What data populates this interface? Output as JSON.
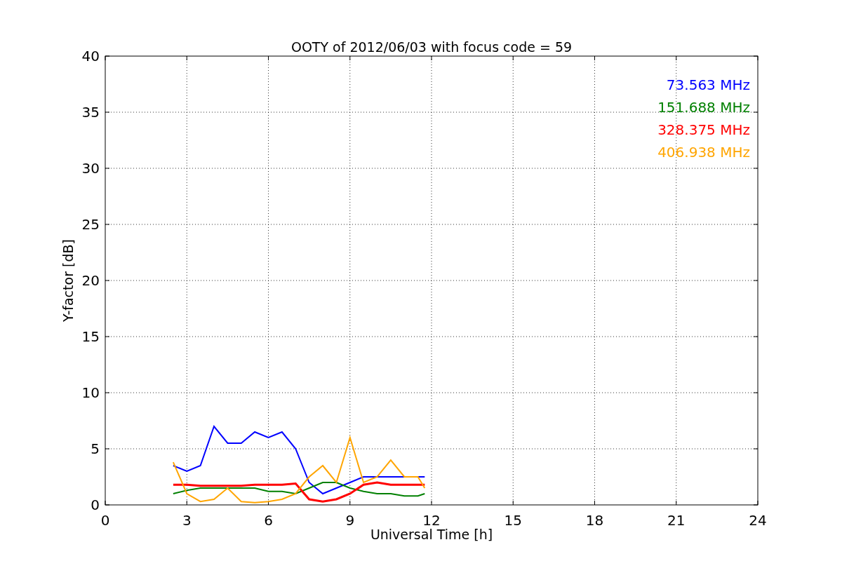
{
  "figure": {
    "chart_data": {
      "type": "line",
      "title": "OOTY of 2012/06/03 with focus code = 59",
      "xlabel": "Universal Time [h]",
      "ylabel": "Y-factor [dB]",
      "x": [
        2.5,
        3,
        3.5,
        4,
        4.5,
        5,
        5.5,
        6,
        6.5,
        7,
        7.5,
        8,
        8.5,
        9,
        9.5,
        10,
        10.5,
        11,
        11.5,
        11.75
      ],
      "series": [
        {
          "name": "73.563 MHz",
          "color": "#0000ff",
          "values": [
            3.5,
            3,
            3.5,
            7,
            5.5,
            5.5,
            6.5,
            6,
            6.5,
            5,
            2,
            1,
            1.5,
            2,
            2.5,
            2.5,
            2.5,
            2.5,
            2.5,
            2.5
          ]
        },
        {
          "name": "151.688 MHz",
          "color": "#008000",
          "values": [
            1,
            1.3,
            1.5,
            1.5,
            1.5,
            1.5,
            1.5,
            1.2,
            1.2,
            1,
            1.5,
            2,
            2,
            1.5,
            1.2,
            1,
            1,
            0.8,
            0.8,
            1
          ]
        },
        {
          "name": "328.375 MHz",
          "color": "#ff0000",
          "values": [
            1.8,
            1.8,
            1.7,
            1.7,
            1.7,
            1.7,
            1.8,
            1.8,
            1.8,
            1.9,
            0.5,
            0.3,
            0.5,
            1,
            1.8,
            2,
            1.8,
            1.8,
            1.8,
            1.8
          ]
        },
        {
          "name": "406.938 MHz",
          "color": "#ffa500",
          "values": [
            3.8,
            1,
            0.3,
            0.5,
            1.5,
            0.3,
            0.2,
            0.3,
            0.5,
            1,
            2.5,
            3.5,
            2,
            6,
            2,
            2.5,
            4,
            2.5,
            2.5,
            1.5
          ]
        }
      ],
      "grid": true,
      "xlim": [
        0,
        24
      ],
      "ylim": [
        0,
        40
      ],
      "xticks": [
        0,
        3,
        6,
        9,
        12,
        15,
        18,
        21,
        24
      ],
      "yticks": [
        0,
        5,
        10,
        15,
        20,
        25,
        30,
        35,
        40
      ]
    }
  }
}
